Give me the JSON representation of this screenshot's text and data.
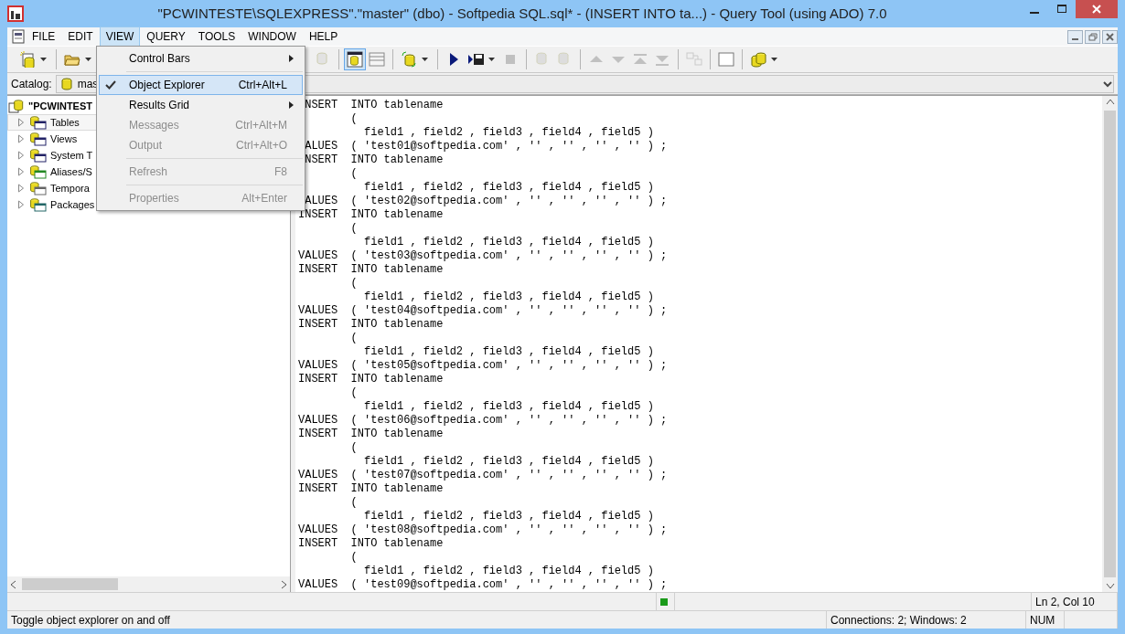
{
  "window": {
    "title": "\"PCWINTESTE\\SQLEXPRESS\".\"master\" (dbo) - Softpedia SQL.sql* - (INSERT  INTO ta...) - Query Tool (using ADO) 7.0"
  },
  "menu_bar": [
    {
      "label": "FILE",
      "selected": false
    },
    {
      "label": "EDIT",
      "selected": false
    },
    {
      "label": "VIEW",
      "selected": true
    },
    {
      "label": "QUERY",
      "selected": false
    },
    {
      "label": "TOOLS",
      "selected": false
    },
    {
      "label": "WINDOW",
      "selected": false
    },
    {
      "label": "HELP",
      "selected": false
    }
  ],
  "view_menu": [
    {
      "kind": "item",
      "label": "Control Bars",
      "submenu": true,
      "checked": false,
      "selected": false,
      "disabled": false
    },
    {
      "kind": "separator"
    },
    {
      "kind": "item",
      "label": "Object Explorer",
      "shortcut": "Ctrl+Alt+L",
      "checked": true,
      "selected": true,
      "disabled": false
    },
    {
      "kind": "item",
      "label": "Results Grid",
      "submenu": true,
      "checked": false,
      "selected": false,
      "disabled": false
    },
    {
      "kind": "item",
      "label": "Messages",
      "shortcut": "Ctrl+Alt+M",
      "checked": false,
      "selected": false,
      "disabled": true
    },
    {
      "kind": "item",
      "label": "Output",
      "shortcut": "Ctrl+Alt+O",
      "checked": false,
      "selected": false,
      "disabled": true
    },
    {
      "kind": "separator"
    },
    {
      "kind": "item",
      "label": "Refresh",
      "shortcut": "F8",
      "checked": false,
      "selected": false,
      "disabled": true
    },
    {
      "kind": "separator"
    },
    {
      "kind": "item",
      "label": "Properties",
      "shortcut": "Alt+Enter",
      "checked": false,
      "selected": false,
      "disabled": true
    }
  ],
  "toolbar": [
    {
      "kind": "button",
      "dropdown": true,
      "disabled": false,
      "selected": false
    },
    {
      "kind": "separator"
    },
    {
      "kind": "button",
      "dropdown": true,
      "disabled": false,
      "selected": false
    },
    {
      "kind": "gap"
    },
    {
      "kind": "button",
      "dropdown": false,
      "disabled": true,
      "selected": false
    },
    {
      "kind": "separator"
    },
    {
      "kind": "button",
      "dropdown": false,
      "disabled": false,
      "selected": true
    },
    {
      "kind": "button",
      "dropdown": false,
      "disabled": false,
      "selected": false
    },
    {
      "kind": "separator"
    },
    {
      "kind": "button",
      "dropdown": true,
      "disabled": false,
      "selected": false
    },
    {
      "kind": "separator"
    },
    {
      "kind": "button",
      "dropdown": false,
      "disabled": false,
      "selected": false
    },
    {
      "kind": "button",
      "dropdown": true,
      "disabled": false,
      "selected": false
    },
    {
      "kind": "button",
      "dropdown": false,
      "disabled": true,
      "selected": false
    },
    {
      "kind": "separator"
    },
    {
      "kind": "button",
      "dropdown": false,
      "disabled": true,
      "selected": false
    },
    {
      "kind": "button",
      "dropdown": false,
      "disabled": true,
      "selected": false
    },
    {
      "kind": "separator"
    },
    {
      "kind": "button",
      "dropdown": false,
      "disabled": true,
      "selected": false
    },
    {
      "kind": "button",
      "dropdown": false,
      "disabled": true,
      "selected": false
    },
    {
      "kind": "button",
      "dropdown": false,
      "disabled": true,
      "selected": false
    },
    {
      "kind": "button",
      "dropdown": false,
      "disabled": true,
      "selected": false
    },
    {
      "kind": "separator"
    },
    {
      "kind": "button",
      "dropdown": false,
      "disabled": true,
      "selected": false
    },
    {
      "kind": "separator"
    },
    {
      "kind": "button",
      "dropdown": false,
      "disabled": false,
      "selected": false
    },
    {
      "kind": "separator"
    },
    {
      "kind": "button",
      "dropdown": true,
      "disabled": false,
      "selected": false
    }
  ],
  "catalog": {
    "label": "Catalog:",
    "value": "mas"
  },
  "object_explorer": {
    "root": "\"PCWINTEST",
    "children": [
      {
        "label": "Tables",
        "selected": true
      },
      {
        "label": "Views",
        "selected": false
      },
      {
        "label": "System T",
        "selected": false
      },
      {
        "label": "Aliases/S",
        "selected": false
      },
      {
        "label": "Tempora",
        "selected": false
      },
      {
        "label": "Packages",
        "selected": false
      }
    ]
  },
  "editor": {
    "lines": [
      " NSERT  INTO tablename",
      "        (",
      "          field1 , field2 , field3 , field4 , field5 )",
      " ALUES  ( 'test01@softpedia.com' , '' , '' , '' , '' ) ;",
      " NSERT  INTO tablename",
      "        (",
      "          field1 , field2 , field3 , field4 , field5 )",
      " ALUES  ( 'test02@softpedia.com' , '' , '' , '' , '' ) ;",
      "INSERT  INTO tablename",
      "        (",
      "          field1 , field2 , field3 , field4 , field5 )",
      "VALUES  ( 'test03@softpedia.com' , '' , '' , '' , '' ) ;",
      "INSERT  INTO tablename",
      "        (",
      "          field1 , field2 , field3 , field4 , field5 )",
      "VALUES  ( 'test04@softpedia.com' , '' , '' , '' , '' ) ;",
      "INSERT  INTO tablename",
      "        (",
      "          field1 , field2 , field3 , field4 , field5 )",
      "VALUES  ( 'test05@softpedia.com' , '' , '' , '' , '' ) ;",
      "INSERT  INTO tablename",
      "        (",
      "          field1 , field2 , field3 , field4 , field5 )",
      "VALUES  ( 'test06@softpedia.com' , '' , '' , '' , '' ) ;",
      "INSERT  INTO tablename",
      "        (",
      "          field1 , field2 , field3 , field4 , field5 )",
      "VALUES  ( 'test07@softpedia.com' , '' , '' , '' , '' ) ;",
      "INSERT  INTO tablename",
      "        (",
      "          field1 , field2 , field3 , field4 , field5 )",
      "VALUES  ( 'test08@softpedia.com' , '' , '' , '' , '' ) ;",
      "INSERT  INTO tablename",
      "        (",
      "          field1 , field2 , field3 , field4 , field5 )",
      "VALUES  ( 'test09@softpedia.com' , '' , '' , '' , '' ) ;"
    ]
  },
  "status_bar": {
    "position": "Ln 2, Col 10",
    "message": "Toggle object explorer on and off",
    "connections": "Connections: 2; Windows: 2",
    "num": "NUM",
    "connected": true
  }
}
